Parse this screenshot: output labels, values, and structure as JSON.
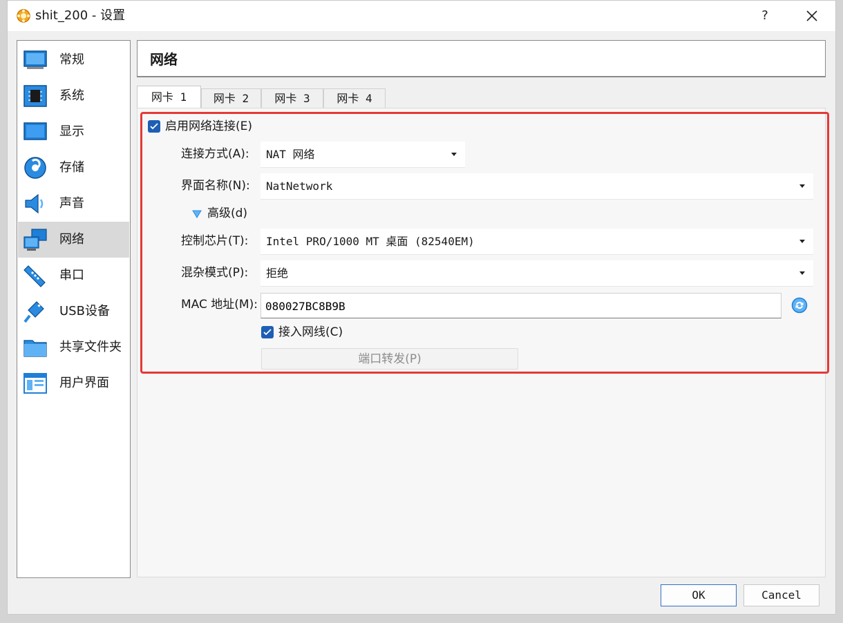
{
  "window": {
    "title": "shit_200 - 设置",
    "help_label": "?"
  },
  "sidebar": {
    "items": [
      {
        "label": "常规",
        "icon": "general-icon"
      },
      {
        "label": "系统",
        "icon": "system-icon"
      },
      {
        "label": "显示",
        "icon": "display-icon"
      },
      {
        "label": "存储",
        "icon": "storage-icon"
      },
      {
        "label": "声音",
        "icon": "audio-icon"
      },
      {
        "label": "网络",
        "icon": "network-icon",
        "active": true
      },
      {
        "label": "串口",
        "icon": "serial-port-icon"
      },
      {
        "label": "USB设备",
        "icon": "usb-icon"
      },
      {
        "label": "共享文件夹",
        "icon": "shared-folder-icon"
      },
      {
        "label": "用户界面",
        "icon": "user-interface-icon"
      }
    ]
  },
  "header": {
    "title": "网络"
  },
  "tabs": [
    {
      "label": "网卡 1",
      "active": true
    },
    {
      "label": "网卡 2"
    },
    {
      "label": "网卡 3"
    },
    {
      "label": "网卡 4"
    }
  ],
  "adapter": {
    "enable_label": "启用网络连接(E)",
    "attached_label": "连接方式(A):",
    "attached_value": "NAT 网络",
    "name_label": "界面名称(N):",
    "name_value": "NatNetwork",
    "advanced_label": "高级(d)",
    "adapter_type_label": "控制芯片(T):",
    "adapter_type_value": "Intel PRO/1000 MT 桌面 (82540EM)",
    "promisc_label": "混杂模式(P):",
    "promisc_value": "拒绝",
    "mac_label": "MAC 地址(M):",
    "mac_value": "080027BC8B9B",
    "cable_label": "接入网线(C)",
    "port_forward_label": "端口转发(P)"
  },
  "buttons": {
    "ok": "OK",
    "cancel": "Cancel"
  },
  "colors": {
    "accent": "#1e5fb4",
    "highlight": "#e53935"
  }
}
